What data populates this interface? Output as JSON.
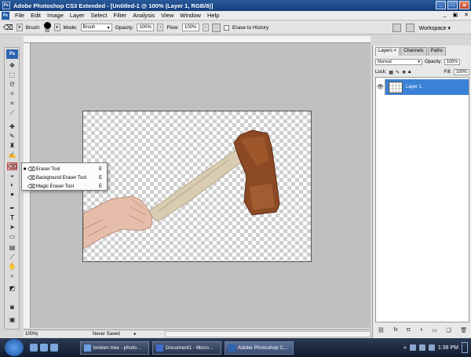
{
  "window": {
    "title": "Adobe Photoshop CS3 Extended - [Untitled-1 @ 100% (Layer 1, RGB/8)]",
    "app_icon": "Ps"
  },
  "menu": {
    "items": [
      "File",
      "Edit",
      "Image",
      "Layer",
      "Select",
      "Filter",
      "Analysis",
      "View",
      "Window",
      "Help"
    ]
  },
  "options": {
    "brush_label": "Brush:",
    "brush_size": "59",
    "mode_label": "Mode:",
    "mode_value": "Brush",
    "opacity_label": "Opacity:",
    "opacity_value": "100%",
    "flow_label": "Flow:",
    "flow_value": "100%",
    "erase_history_label": "Erase to History",
    "workspace_label": "Workspace"
  },
  "toolbox": {
    "logo": "Ps"
  },
  "flyout": {
    "items": [
      {
        "label": "Eraser Tool",
        "key": "E",
        "selected": true
      },
      {
        "label": "Background Eraser Tool",
        "key": "E",
        "selected": false
      },
      {
        "label": "Magic Eraser Tool",
        "key": "E",
        "selected": false
      }
    ]
  },
  "status": {
    "zoom": "100%",
    "info": "Never Saved"
  },
  "layers_panel": {
    "tabs": [
      "Layers",
      "Channels",
      "Paths"
    ],
    "active_tab": "Layers",
    "blend_mode": "Normal",
    "opacity_label": "Opacity:",
    "opacity_value": "100%",
    "lock_label": "Lock:",
    "fill_label": "Fill:",
    "fill_value": "100%",
    "layers": [
      {
        "name": "Layer 1",
        "visible": true,
        "selected": true
      }
    ]
  },
  "taskbar": {
    "tasks": [
      {
        "label": "broken tree - photo...",
        "active": false
      },
      {
        "label": "Document1 - Micro...",
        "active": false
      },
      {
        "label": "Adobe Photoshop C...",
        "active": true
      }
    ],
    "clock": "1:38 PM"
  },
  "colors": {
    "title_bar": "#143e7a",
    "selection": "#3b82d6",
    "canvas_bg": "#c0c0c0"
  }
}
